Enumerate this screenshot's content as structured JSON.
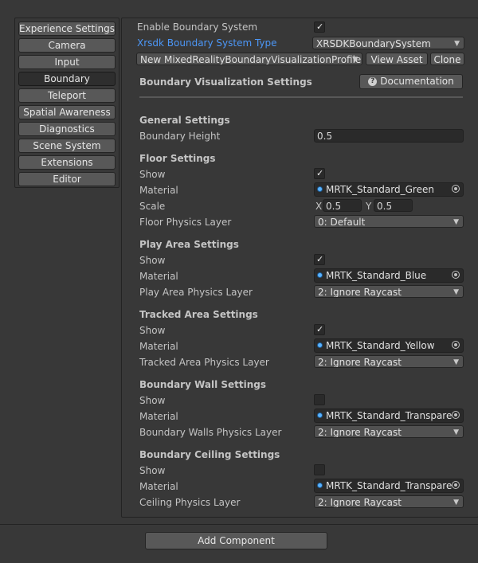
{
  "sidebar": {
    "items": [
      {
        "label": "Experience Settings",
        "active": false
      },
      {
        "label": "Camera",
        "active": false
      },
      {
        "label": "Input",
        "active": false
      },
      {
        "label": "Boundary",
        "active": true
      },
      {
        "label": "Teleport",
        "active": false
      },
      {
        "label": "Spatial Awareness",
        "active": false
      },
      {
        "label": "Diagnostics",
        "active": false
      },
      {
        "label": "Scene System",
        "active": false
      },
      {
        "label": "Extensions",
        "active": false
      },
      {
        "label": "Editor",
        "active": false
      }
    ]
  },
  "top": {
    "enable_label": "Enable Boundary System",
    "enable_checked": true,
    "type_label": "Xrsdk Boundary System Type",
    "type_value": "XRSDKBoundarySystem",
    "profile_value": "New MixedRealityBoundaryVisualizationProfile",
    "view_asset": "View Asset",
    "clone": "Clone"
  },
  "visualization": {
    "title": "Boundary Visualization Settings",
    "doc_button": "Documentation",
    "doc_icon": "help-icon"
  },
  "general": {
    "title": "General Settings",
    "height_label": "Boundary Height",
    "height_value": "0.5"
  },
  "floor": {
    "title": "Floor Settings",
    "show_label": "Show",
    "show_checked": true,
    "material_label": "Material",
    "material_value": "MRTK_Standard_Green",
    "scale_label": "Scale",
    "scale_x_label": "X",
    "scale_x": "0.5",
    "scale_y_label": "Y",
    "scale_y": "0.5",
    "layer_label": "Floor Physics Layer",
    "layer_value": "0: Default"
  },
  "play_area": {
    "title": "Play Area Settings",
    "show_label": "Show",
    "show_checked": true,
    "material_label": "Material",
    "material_value": "MRTK_Standard_Blue",
    "layer_label": "Play Area Physics Layer",
    "layer_value": "2: Ignore Raycast"
  },
  "tracked_area": {
    "title": "Tracked Area Settings",
    "show_label": "Show",
    "show_checked": true,
    "material_label": "Material",
    "material_value": "MRTK_Standard_Yellow",
    "layer_label": "Tracked Area Physics Layer",
    "layer_value": "2: Ignore Raycast"
  },
  "wall": {
    "title": "Boundary Wall Settings",
    "show_label": "Show",
    "show_checked": false,
    "material_label": "Material",
    "material_value": "MRTK_Standard_Transpare",
    "layer_label": "Boundary Walls Physics Layer",
    "layer_value": "2: Ignore Raycast"
  },
  "ceiling": {
    "title": "Boundary Ceiling Settings",
    "show_label": "Show",
    "show_checked": false,
    "material_label": "Material",
    "material_value": "MRTK_Standard_Transpare",
    "layer_label": "Ceiling Physics Layer",
    "layer_value": "2: Ignore Raycast"
  },
  "footer": {
    "add_component": "Add Component"
  },
  "colors": {
    "background": "#383838",
    "link": "#4c97f7",
    "button": "#585858",
    "active_tab": "#2e2e2e",
    "field": "#2a2a2a",
    "material_dot": "#5ab3ff"
  }
}
